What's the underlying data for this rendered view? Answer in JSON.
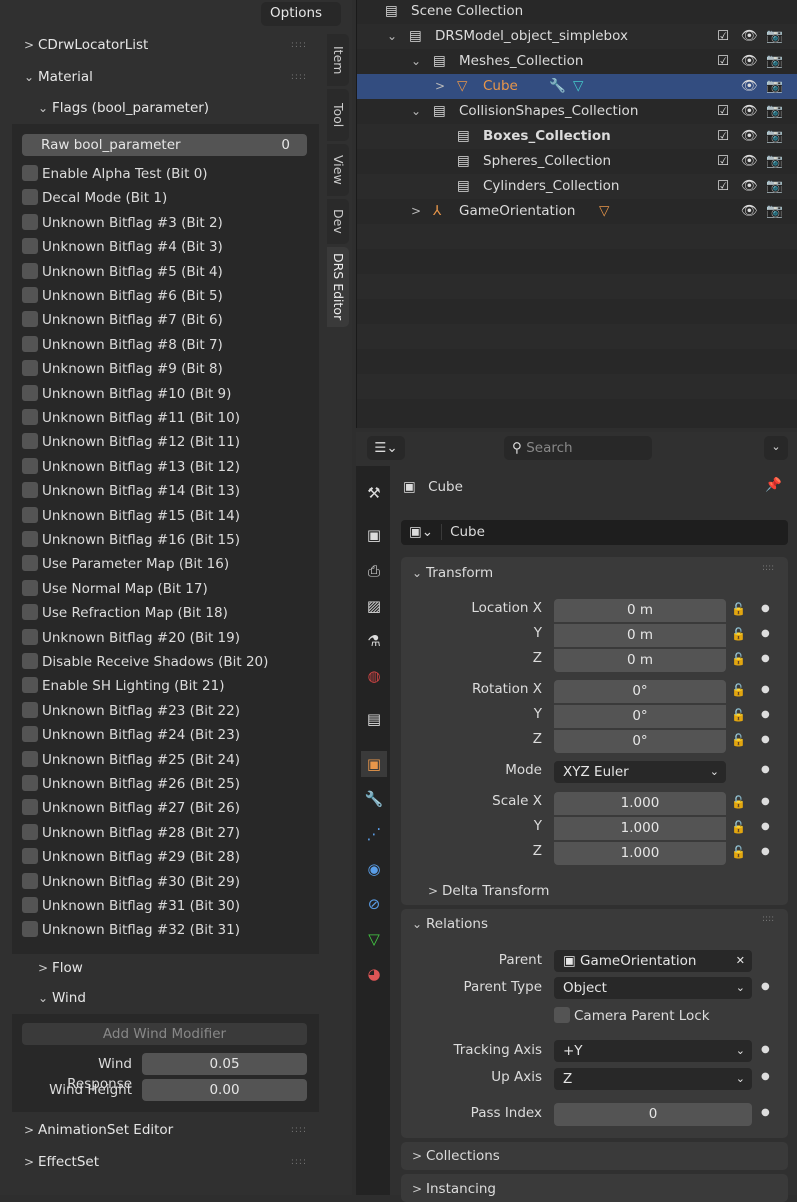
{
  "viewport": {
    "options_label": "Options"
  },
  "npanel": {
    "sections": {
      "locator": "CDrwLocatorList",
      "material": "Material",
      "flags": "Flags (bool_parameter)",
      "flow": "Flow",
      "wind": "Wind",
      "animset": "AnimationSet Editor",
      "effectset": "EffectSet"
    },
    "raw_label": "Raw bool_parameter",
    "raw_value": "0",
    "flags": [
      "Enable Alpha Test (Bit 0)",
      "Decal Mode (Bit 1)",
      "Unknown Bitflag #3 (Bit 2)",
      "Unknown Bitflag #4 (Bit 3)",
      "Unknown Bitflag #5 (Bit 4)",
      "Unknown Bitflag #6 (Bit 5)",
      "Unknown Bitflag #7 (Bit 6)",
      "Unknown Bitflag #8 (Bit 7)",
      "Unknown Bitflag #9 (Bit 8)",
      "Unknown Bitflag #10 (Bit 9)",
      "Unknown Bitflag #11 (Bit 10)",
      "Unknown Bitflag #12 (Bit 11)",
      "Unknown Bitflag #13 (Bit 12)",
      "Unknown Bitflag #14 (Bit 13)",
      "Unknown Bitflag #15 (Bit 14)",
      "Unknown Bitflag #16 (Bit 15)",
      "Use Parameter Map (Bit 16)",
      "Use Normal Map (Bit 17)",
      "Use Refraction Map (Bit 18)",
      "Unknown Bitflag #20 (Bit 19)",
      "Disable Receive Shadows (Bit 20)",
      "Enable SH Lighting (Bit 21)",
      "Unknown Bitflag #23 (Bit 22)",
      "Unknown Bitflag #24 (Bit 23)",
      "Unknown Bitflag #25 (Bit 24)",
      "Unknown Bitflag #26 (Bit 25)",
      "Unknown Bitflag #27 (Bit 26)",
      "Unknown Bitflag #28 (Bit 27)",
      "Unknown Bitflag #29 (Bit 28)",
      "Unknown Bitflag #30 (Bit 29)",
      "Unknown Bitflag #31 (Bit 30)",
      "Unknown Bitflag #32 (Bit 31)"
    ],
    "wind": {
      "add_label": "Add Wind Modifier",
      "response_label": "Wind Response",
      "response_value": "0.05",
      "height_label": "Wind Height",
      "height_value": "0.00"
    },
    "tabs": [
      "Item",
      "Tool",
      "View",
      "Dev",
      "DRS Editor"
    ]
  },
  "outliner": {
    "rows": [
      {
        "label": "Scene Collection",
        "indent": 0,
        "type": "collection",
        "chev": "",
        "check": false,
        "eye": false
      },
      {
        "label": "DRSModel_object_simplebox",
        "indent": 1,
        "type": "collection",
        "chev": "v",
        "check": true,
        "eye": true
      },
      {
        "label": "Meshes_Collection",
        "indent": 2,
        "type": "collection",
        "chev": "v",
        "check": true,
        "eye": true
      },
      {
        "label": "Cube",
        "indent": 3,
        "type": "mesh",
        "chev": ">",
        "check": false,
        "eye": true,
        "selected": true
      },
      {
        "label": "CollisionShapes_Collection",
        "indent": 2,
        "type": "collection",
        "chev": "v",
        "check": true,
        "eye": true
      },
      {
        "label": "Boxes_Collection",
        "indent": 3,
        "type": "collection",
        "chev": "",
        "check": true,
        "eye": true,
        "active": true
      },
      {
        "label": "Spheres_Collection",
        "indent": 3,
        "type": "collection",
        "chev": "",
        "check": true,
        "eye": true
      },
      {
        "label": "Cylinders_Collection",
        "indent": 3,
        "type": "collection",
        "chev": "",
        "check": true,
        "eye": true
      },
      {
        "label": "GameOrientation",
        "indent": 2,
        "type": "armature",
        "chev": ">",
        "check": false,
        "eye": true
      }
    ]
  },
  "properties": {
    "search_placeholder": "Search",
    "object_name": "Cube",
    "name_field": "Cube",
    "transform": {
      "title": "Transform",
      "location_label": "Location X",
      "rotation_label": "Rotation X",
      "scale_label": "Scale X",
      "y": "Y",
      "z": "Z",
      "location": [
        "0 m",
        "0 m",
        "0 m"
      ],
      "rotation": [
        "0°",
        "0°",
        "0°"
      ],
      "scale": [
        "1.000",
        "1.000",
        "1.000"
      ],
      "mode_label": "Mode",
      "mode": "XYZ Euler",
      "delta": "Delta Transform"
    },
    "relations": {
      "title": "Relations",
      "parent_label": "Parent",
      "parent": "GameOrientation",
      "parent_type_label": "Parent Type",
      "parent_type": "Object",
      "camera_lock": "Camera Parent Lock",
      "tracking_label": "Tracking Axis",
      "tracking": "+Y",
      "up_label": "Up Axis",
      "up": "Z",
      "pass_label": "Pass Index",
      "pass": "0"
    },
    "collections": "Collections",
    "instancing": "Instancing"
  },
  "colors": {
    "selection": "#334d80",
    "mesh_icon": "#e8964a"
  }
}
